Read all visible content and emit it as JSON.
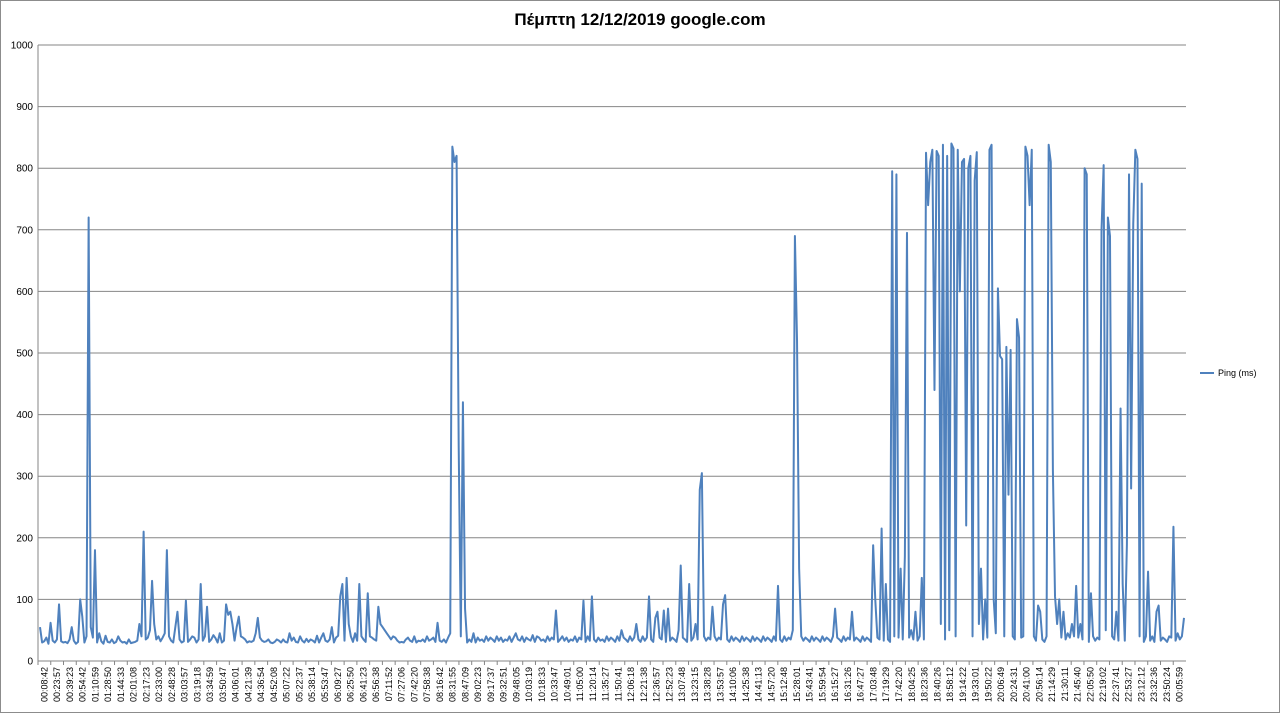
{
  "chart_data": {
    "type": "line",
    "title": "Πέμπτη 12/12/2019 google.com",
    "xlabel": "",
    "ylabel": "",
    "ylim": [
      0,
      1000
    ],
    "yticks": [
      0,
      100,
      200,
      300,
      400,
      500,
      600,
      700,
      800,
      900,
      1000
    ],
    "grid": true,
    "legend_position": "right",
    "series_color": "#4f81bd",
    "categories": [
      "00:08:42",
      "00:23:57",
      "00:39:23",
      "00:54:42",
      "01:10:59",
      "01:28:50",
      "01:44:33",
      "02:01:08",
      "02:17:23",
      "02:33:00",
      "02:48:28",
      "03:03:57",
      "03:19:18",
      "03:34:59",
      "03:50:47",
      "04:06:01",
      "04:21:39",
      "04:36:54",
      "04:52:08",
      "05:07:22",
      "05:22:37",
      "05:38:14",
      "05:53:47",
      "06:09:27",
      "06:25:50",
      "06:41:23",
      "06:56:38",
      "07:11:52",
      "07:27:06",
      "07:42:20",
      "07:58:38",
      "08:16:42",
      "08:31:55",
      "08:47:09",
      "09:02:23",
      "09:17:37",
      "09:32:51",
      "09:48:05",
      "10:03:19",
      "10:18:33",
      "10:33:47",
      "10:49:01",
      "11:05:00",
      "11:20:14",
      "11:35:27",
      "11:50:41",
      "12:06:18",
      "12:21:38",
      "12:36:57",
      "12:52:23",
      "13:07:48",
      "13:23:15",
      "13:38:28",
      "13:53:57",
      "14:10:06",
      "14:25:38",
      "14:41:13",
      "14:57:20",
      "15:12:48",
      "15:28:01",
      "15:43:41",
      "15:59:54",
      "16:15:27",
      "16:31:26",
      "16:47:27",
      "17:03:48",
      "17:19:29",
      "17:42:20",
      "18:04:25",
      "18:23:36",
      "18:40:26",
      "18:58:12",
      "19:14:22",
      "19:33:01",
      "19:50:22",
      "20:06:49",
      "20:24:31",
      "20:41:00",
      "20:56:14",
      "21:14:29",
      "21:30:11",
      "21:45:40",
      "22:05:50",
      "22:19:02",
      "22:37:41",
      "22:53:27",
      "23:12:12",
      "23:32:36",
      "23:50:24",
      "00:05:59"
    ],
    "series": [
      {
        "name": "Ping (ms)",
        "values": [
          55,
          30,
          32,
          38,
          28,
          62,
          33,
          30,
          35,
          92,
          32,
          30,
          31,
          29,
          35,
          55,
          33,
          28,
          31,
          100,
          72,
          30,
          40,
          720,
          55,
          38,
          180,
          30,
          45,
          32,
          28,
          41,
          31,
          30,
          35,
          29,
          31,
          40,
          33,
          30,
          31,
          28,
          35,
          29,
          30,
          31,
          33,
          60,
          40,
          210,
          35,
          38,
          50,
          130,
          60,
          35,
          40,
          32,
          38,
          45,
          180,
          40,
          33,
          30,
          55,
          80,
          35,
          30,
          32,
          98,
          31,
          35,
          40,
          38,
          30,
          35,
          125,
          33,
          40,
          88,
          31,
          35,
          42,
          37,
          30,
          45,
          30,
          33,
          92,
          75,
          80,
          60,
          33,
          55,
          72,
          40,
          38,
          35,
          30,
          32,
          31,
          33,
          45,
          70,
          38,
          33,
          31,
          32,
          35,
          30,
          29,
          31,
          35,
          33,
          30,
          35,
          31,
          30,
          45,
          33,
          38,
          31,
          30,
          40,
          33,
          30,
          36,
          31,
          35,
          33,
          30,
          41,
          30,
          38,
          45,
          33,
          31,
          35,
          55,
          30,
          38,
          41,
          105,
          125,
          33,
          135,
          60,
          40,
          31,
          45,
          33,
          125,
          40,
          35,
          31,
          110,
          40,
          38,
          35,
          33,
          88,
          60,
          55,
          50,
          45,
          40,
          35,
          40,
          38,
          33,
          30,
          31,
          30,
          35,
          38,
          33,
          31,
          40,
          30,
          33,
          32,
          35,
          31,
          40,
          33,
          35,
          38,
          31,
          62,
          33,
          31,
          35,
          30,
          38,
          45,
          835,
          810,
          820,
          350,
          40,
          420,
          85,
          30,
          35,
          31,
          45,
          30,
          38,
          33,
          35,
          31,
          40,
          33,
          38,
          35,
          31,
          40,
          33,
          38,
          31,
          35,
          33,
          40,
          31,
          38,
          45,
          35,
          33,
          40,
          31,
          38,
          35,
          33,
          42,
          31,
          40,
          38,
          33,
          35,
          31,
          40,
          33,
          38,
          35,
          82,
          31,
          35,
          40,
          33,
          38,
          31,
          35,
          33,
          40,
          31,
          38,
          35,
          98,
          31,
          40,
          33,
          105,
          35,
          31,
          38,
          33,
          35,
          31,
          40,
          33,
          38,
          35,
          31,
          40,
          33,
          50,
          38,
          35,
          31,
          40,
          33,
          38,
          60,
          35,
          31,
          40,
          33,
          38,
          105,
          35,
          31,
          70,
          80,
          38,
          35,
          82,
          31,
          85,
          33,
          38,
          35,
          31,
          50,
          155,
          38,
          35,
          31,
          125,
          33,
          38,
          60,
          35,
          278,
          305,
          40,
          33,
          38,
          35,
          88,
          40,
          33,
          38,
          35,
          92,
          107,
          35,
          31,
          40,
          33,
          38,
          35,
          31,
          40,
          33,
          38,
          35,
          31,
          40,
          33,
          38,
          35,
          31,
          40,
          33,
          38,
          35,
          31,
          40,
          33,
          122,
          35,
          31,
          40,
          33,
          38,
          35,
          50,
          690,
          520,
          150,
          40,
          33,
          38,
          35,
          31,
          40,
          33,
          38,
          35,
          31,
          40,
          33,
          38,
          35,
          31,
          40,
          85,
          38,
          35,
          31,
          40,
          33,
          38,
          35,
          80,
          33,
          38,
          35,
          31,
          40,
          33,
          38,
          35,
          31,
          188,
          100,
          38,
          35,
          215,
          33,
          125,
          35,
          31,
          795,
          40,
          790,
          38,
          150,
          35,
          170,
          695,
          38,
          50,
          35,
          80,
          33,
          40,
          135,
          35,
          825,
          740,
          810,
          830,
          440,
          828,
          820,
          60,
          838,
          35,
          820,
          50,
          840,
          832,
          40,
          830,
          600,
          810,
          815,
          220,
          800,
          820,
          40,
          780,
          826,
          60,
          150,
          35,
          100,
          38,
          830,
          838,
          100,
          45,
          605,
          495,
          490,
          40,
          510,
          270,
          505,
          40,
          35,
          555,
          525,
          38,
          40,
          835,
          820,
          740,
          830,
          40,
          33,
          90,
          80,
          35,
          31,
          40,
          838,
          810,
          310,
          105,
          60,
          100,
          38,
          80,
          35,
          45,
          38,
          60,
          40,
          122,
          38,
          60,
          35,
          800,
          790,
          31,
          110,
          40,
          33,
          38,
          35,
          700,
          805,
          50,
          720,
          690,
          40,
          35,
          80,
          33,
          410,
          125,
          33,
          190,
          790,
          280,
          710,
          830,
          815,
          40,
          775,
          31,
          40,
          145,
          33,
          40,
          31,
          80,
          90,
          33,
          38,
          35,
          31,
          40,
          38,
          218,
          33,
          45,
          35,
          40,
          70
        ]
      }
    ]
  }
}
